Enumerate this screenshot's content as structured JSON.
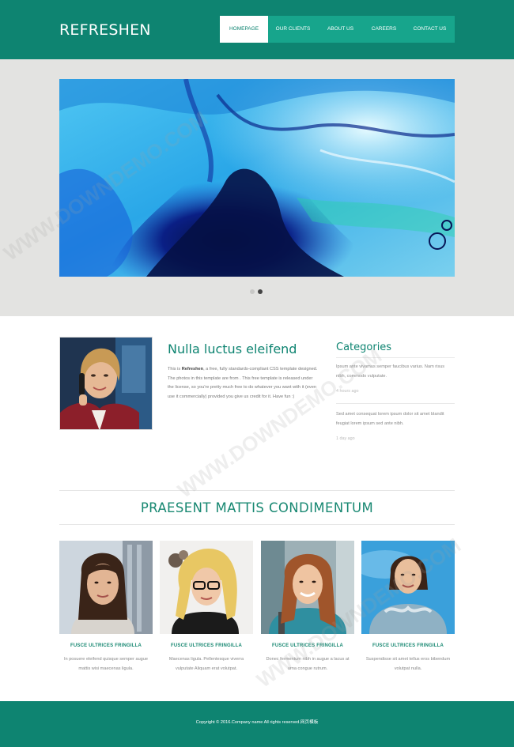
{
  "header": {
    "logo": "REFRESHEN",
    "nav": [
      "HOMEPAGE",
      "OUR CLIENTS",
      "ABOUT US",
      "CAREERS",
      "CONTACT US"
    ],
    "active_index": 0
  },
  "slider": {
    "dots": 2,
    "active_dot": 1
  },
  "about": {
    "title": "Nulla luctus eleifend",
    "text_pre": "This is ",
    "text_bold": "Refreshen",
    "text_post": ", a free, fully standards-compliant CSS template designed. The photos in this template are from . This free template is released under the license, so you're pretty much free to do whatever you want with it (even use it commercially) provided you give us credit for it. Have fun :)"
  },
  "categories": {
    "title": "Categories",
    "items": [
      {
        "text": "Ipsum ante vivamus semper faucibus varius. Nam risus nibh, commodo vulputate.",
        "time": "4 hours ago"
      },
      {
        "text": "Sed amet consequat lorem ipsum dolor sit amet blandit feugiat lorem ipsum sed ante nibh.",
        "time": "1 day ago"
      }
    ]
  },
  "section": {
    "title": "PRAESENT MATTIS CONDIMENTUM"
  },
  "team": [
    {
      "name": "FUSCE ULTRICES FRINGILLA",
      "desc": "In posuere eleifend quisque semper augue mattis wisi maecenas ligula."
    },
    {
      "name": "FUSCE ULTRICES FRINGILLA",
      "desc": "Maecenas ligula. Pellentesque viverra vulputate Aliquam erat volutpat."
    },
    {
      "name": "FUSCE ULTRICES FRINGILLA",
      "desc": "Donec fermentum nibh in augue a lacus at urna congue rutrum."
    },
    {
      "name": "FUSCE ULTRICES FRINGILLA",
      "desc": "Suspendisse sit amet tellus eros bibendum volutpat nulla."
    }
  ],
  "footer": {
    "copyright": "Copyright © 2016.Company name All rights reserved.",
    "link": "网页模板"
  },
  "watermark": "WWW.DOWNDEMO.COM",
  "colors": {
    "primary": "#0e8471",
    "nav_bg": "#17a58c",
    "banner_bg": "#e3e3e1"
  }
}
